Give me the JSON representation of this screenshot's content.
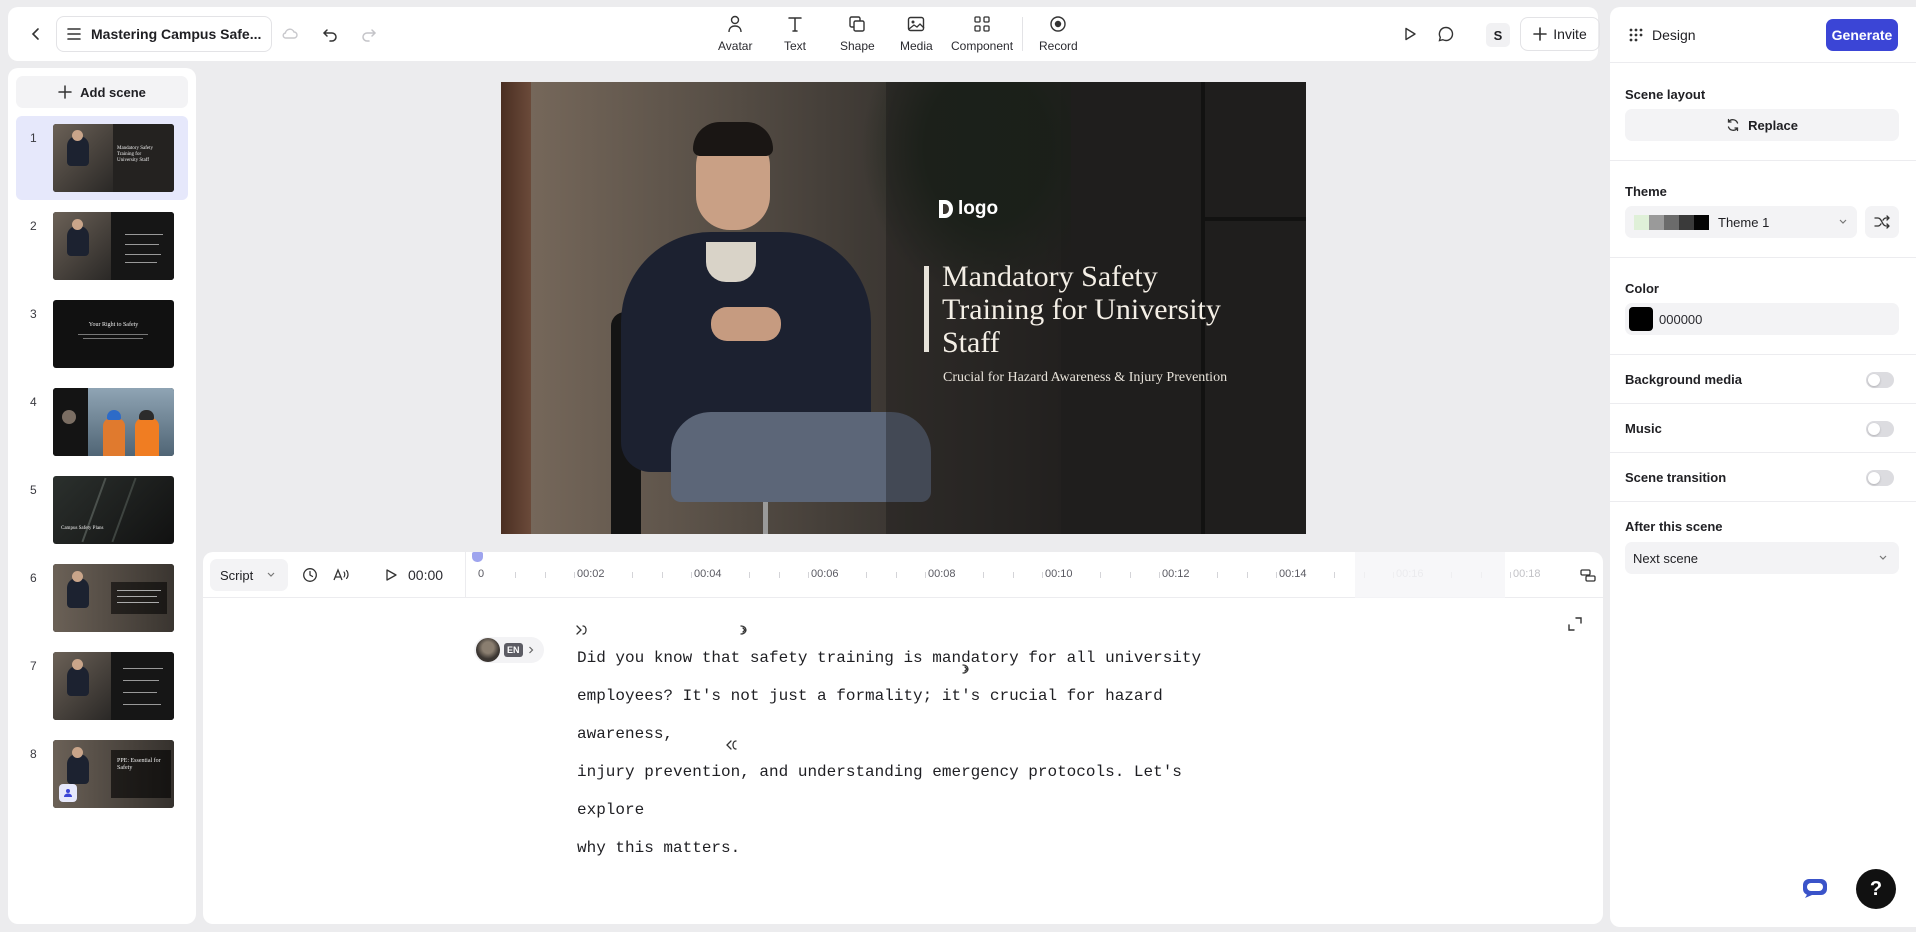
{
  "header": {
    "project_name": "Mastering Campus Safe...",
    "tools": [
      {
        "label": "Avatar",
        "icon": "avatar-icon"
      },
      {
        "label": "Text",
        "icon": "text-icon"
      },
      {
        "label": "Shape",
        "icon": "shape-icon"
      },
      {
        "label": "Media",
        "icon": "media-icon"
      },
      {
        "label": "Component",
        "icon": "component-icon"
      },
      {
        "label": "Record",
        "icon": "record-icon"
      }
    ],
    "user_initial": "S",
    "invite_label": "Invite"
  },
  "sidebar": {
    "add_scene_label": "Add scene",
    "scenes": [
      {
        "number": "1",
        "active": true,
        "thumb_text": "Mandatory Safety Training for University Staff"
      },
      {
        "number": "2",
        "active": false
      },
      {
        "number": "3",
        "active": false,
        "thumb_text": "Your Right to Safety"
      },
      {
        "number": "4",
        "active": false
      },
      {
        "number": "5",
        "active": false,
        "thumb_text": "Campus Safety Plans"
      },
      {
        "number": "6",
        "active": false
      },
      {
        "number": "7",
        "active": false
      },
      {
        "number": "8",
        "active": false,
        "thumb_text": "PPE: Essential for Safety"
      }
    ]
  },
  "canvas": {
    "logo_text": "logo",
    "title": "Mandatory Safety Training for University Staff",
    "subtitle": "Crucial for Hazard Awareness & Injury Prevention"
  },
  "timeline": {
    "mode": "Script",
    "current_time": "00:00",
    "ticks": [
      "0",
      "00:02",
      "00:04",
      "00:06",
      "00:08",
      "00:10",
      "00:12",
      "00:14",
      "00:16",
      "00:18"
    ]
  },
  "script": {
    "language": "EN",
    "lines": [
      "Did you know that safety training is mandatory for all university",
      "employees? It's not just a formality; it's crucial for hazard awareness,",
      "injury prevention, and understanding emergency protocols. Let's explore",
      "why this matters."
    ]
  },
  "design_panel": {
    "title": "Design",
    "generate_label": "Generate",
    "scene_layout_label": "Scene layout",
    "replace_label": "Replace",
    "theme_label": "Theme",
    "theme_value": "Theme 1",
    "theme_swatches": [
      "#dff0d8",
      "#9a9a9a",
      "#6b6b6b",
      "#3a3a3a",
      "#050505"
    ],
    "color_label": "Color",
    "color_value": "000000",
    "color_hex": "#000000",
    "background_media_label": "Background media",
    "music_label": "Music",
    "scene_transition_label": "Scene transition",
    "after_scene_label": "After this scene",
    "after_scene_value": "Next scene"
  },
  "colors": {
    "accent": "#3b45d6",
    "active_scene": "#e6e8fb",
    "playhead": "#9ea4ee"
  }
}
